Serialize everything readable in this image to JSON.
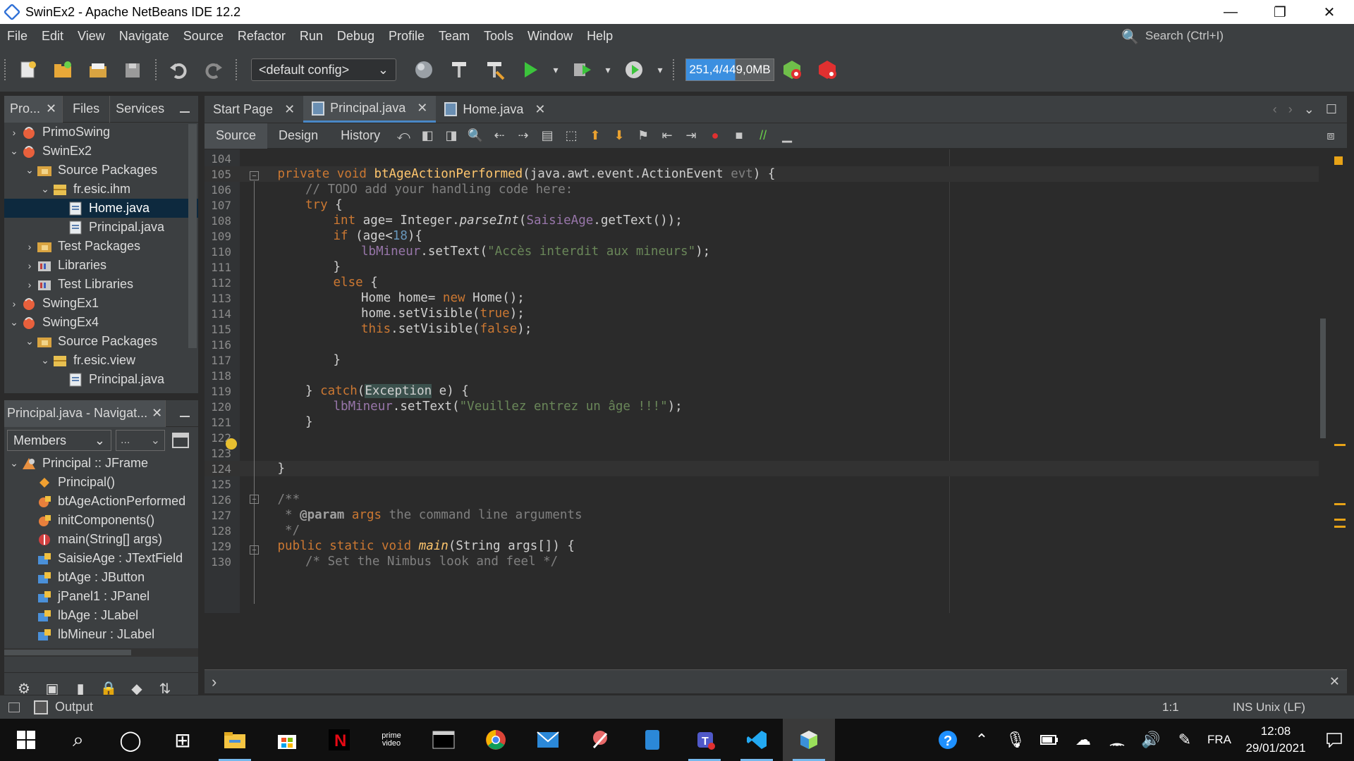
{
  "window": {
    "title": "SwinEx2 - Apache NetBeans IDE 12.2",
    "minimize": "—",
    "restore": "❐",
    "close": "✕"
  },
  "menu": {
    "items": [
      "File",
      "Edit",
      "View",
      "Navigate",
      "Source",
      "Refactor",
      "Run",
      "Debug",
      "Profile",
      "Team",
      "Tools",
      "Window",
      "Help"
    ],
    "search_placeholder": "Search (Ctrl+I)"
  },
  "toolbar": {
    "config": "<default config>",
    "memory": "251,4/449,0MB",
    "memory_used_fraction": 0.56
  },
  "projects_panel": {
    "tabs": [
      "Pro...",
      "Files",
      "Services"
    ],
    "tree": [
      {
        "label": "PrimoSwing",
        "level": 0,
        "expander": "›",
        "icon": "project-icon",
        "selected": false
      },
      {
        "label": "SwinEx2",
        "level": 0,
        "expander": "⌄",
        "icon": "project-icon",
        "selected": false
      },
      {
        "label": "Source Packages",
        "level": 1,
        "expander": "⌄",
        "icon": "package-folder-icon",
        "selected": false
      },
      {
        "label": "fr.esic.ihm",
        "level": 2,
        "expander": "⌄",
        "icon": "package-icon",
        "selected": false
      },
      {
        "label": "Home.java",
        "level": 3,
        "expander": "",
        "icon": "java-file-icon",
        "selected": true
      },
      {
        "label": "Principal.java",
        "level": 3,
        "expander": "",
        "icon": "java-file-icon",
        "selected": false
      },
      {
        "label": "Test Packages",
        "level": 1,
        "expander": "›",
        "icon": "package-folder-icon",
        "selected": false
      },
      {
        "label": "Libraries",
        "level": 1,
        "expander": "›",
        "icon": "library-icon",
        "selected": false
      },
      {
        "label": "Test Libraries",
        "level": 1,
        "expander": "›",
        "icon": "library-icon",
        "selected": false
      },
      {
        "label": "SwingEx1",
        "level": 0,
        "expander": "›",
        "icon": "project-icon",
        "selected": false
      },
      {
        "label": "SwingEx4",
        "level": 0,
        "expander": "⌄",
        "icon": "project-icon",
        "selected": false
      },
      {
        "label": "Source Packages",
        "level": 1,
        "expander": "⌄",
        "icon": "package-folder-icon",
        "selected": false
      },
      {
        "label": "fr.esic.view",
        "level": 2,
        "expander": "⌄",
        "icon": "package-icon",
        "selected": false
      },
      {
        "label": "Principal.java",
        "level": 3,
        "expander": "",
        "icon": "java-file-icon",
        "selected": false
      }
    ]
  },
  "navigator_panel": {
    "title": "Principal.java - Navigat...",
    "members_select": "Members",
    "filter_select": "...",
    "tree": [
      {
        "label": "Principal :: JFrame",
        "level": 0,
        "expander": "⌄",
        "icon": "class-icon"
      },
      {
        "label": "Principal()",
        "level": 1,
        "expander": "",
        "icon": "constructor-icon"
      },
      {
        "label": "btAgeActionPerformed",
        "level": 1,
        "expander": "",
        "icon": "private-method-icon"
      },
      {
        "label": "initComponents()",
        "level": 1,
        "expander": "",
        "icon": "private-method-icon"
      },
      {
        "label": "main(String[] args)",
        "level": 1,
        "expander": "",
        "icon": "static-method-icon"
      },
      {
        "label": "SaisieAge : JTextField",
        "level": 1,
        "expander": "",
        "icon": "private-field-icon"
      },
      {
        "label": "btAge : JButton",
        "level": 1,
        "expander": "",
        "icon": "private-field-icon"
      },
      {
        "label": "jPanel1 : JPanel",
        "level": 1,
        "expander": "",
        "icon": "private-field-icon"
      },
      {
        "label": "lbAge : JLabel",
        "level": 1,
        "expander": "",
        "icon": "private-field-icon"
      },
      {
        "label": "lbMineur : JLabel",
        "level": 1,
        "expander": "",
        "icon": "private-field-icon"
      }
    ]
  },
  "editor": {
    "tabs": [
      {
        "label": "Start Page",
        "active": false,
        "file": false
      },
      {
        "label": "Principal.java",
        "active": true,
        "file": true
      },
      {
        "label": "Home.java",
        "active": false,
        "file": true
      }
    ],
    "subtabs": [
      "Source",
      "Design",
      "History"
    ],
    "lines": [
      {
        "n": "104",
        "indent": 0,
        "segs": []
      },
      {
        "n": "105",
        "indent": 1,
        "segs": [
          [
            "kw",
            "private void "
          ],
          [
            "fn",
            "btAgeActionPerformed"
          ],
          [
            "",
            "(java.awt.event.ActionEvent "
          ],
          [
            "cmt",
            "evt"
          ],
          [
            "",
            ") {"
          ]
        ]
      },
      {
        "n": "106",
        "indent": 2,
        "segs": [
          [
            "cmt",
            "// TODO add your handling code here:"
          ]
        ]
      },
      {
        "n": "107",
        "indent": 2,
        "segs": [
          [
            "kw",
            "try"
          ],
          [
            "",
            " {"
          ]
        ]
      },
      {
        "n": "108",
        "indent": 3,
        "segs": [
          [
            "kw",
            "int "
          ],
          [
            "",
            "age= Integer."
          ],
          [
            "ital",
            "parseInt"
          ],
          [
            "",
            "("
          ],
          [
            "fld",
            "SaisieAge"
          ],
          [
            "",
            ".getText());"
          ]
        ]
      },
      {
        "n": "109",
        "indent": 3,
        "segs": [
          [
            "kw",
            "if "
          ],
          [
            "",
            "(age<"
          ],
          [
            "num",
            "18"
          ],
          [
            "",
            "){"
          ]
        ]
      },
      {
        "n": "110",
        "indent": 4,
        "segs": [
          [
            "fld",
            "lbMineur"
          ],
          [
            "",
            ".setText("
          ],
          [
            "str",
            "\"Accès interdit aux mineurs\""
          ],
          [
            "",
            ");"
          ]
        ]
      },
      {
        "n": "111",
        "indent": 3,
        "segs": [
          [
            "",
            "}"
          ]
        ]
      },
      {
        "n": "112",
        "indent": 3,
        "segs": [
          [
            "kw",
            "else "
          ],
          [
            "",
            "{"
          ]
        ]
      },
      {
        "n": "113",
        "indent": 4,
        "segs": [
          [
            "",
            "Home home= "
          ],
          [
            "kw",
            "new "
          ],
          [
            "",
            "Home();"
          ]
        ]
      },
      {
        "n": "114",
        "indent": 4,
        "segs": [
          [
            "",
            "home.setVisible("
          ],
          [
            "kw",
            "true"
          ],
          [
            "",
            ");"
          ]
        ]
      },
      {
        "n": "115",
        "indent": 4,
        "segs": [
          [
            "kw",
            "this"
          ],
          [
            "",
            ".setVisible("
          ],
          [
            "kw",
            "false"
          ],
          [
            "",
            ");"
          ]
        ]
      },
      {
        "n": "116",
        "indent": 0,
        "segs": []
      },
      {
        "n": "117",
        "indent": 3,
        "segs": [
          [
            "",
            "}"
          ]
        ]
      },
      {
        "n": "118",
        "indent": 0,
        "segs": []
      },
      {
        "n": "119",
        "indent": 2,
        "segs": [
          [
            "",
            "} "
          ],
          [
            "kw",
            "catch"
          ],
          [
            "",
            "("
          ],
          [
            "hl",
            "Exception"
          ],
          [
            "",
            " e) {"
          ]
        ]
      },
      {
        "n": "120",
        "indent": 3,
        "segs": [
          [
            "fld",
            "lbMineur"
          ],
          [
            "",
            ".setText("
          ],
          [
            "str",
            "\"Veuillez entrez un âge !!!\""
          ],
          [
            "",
            ");"
          ]
        ]
      },
      {
        "n": "121",
        "indent": 2,
        "segs": [
          [
            "",
            "}"
          ]
        ]
      },
      {
        "n": "122",
        "indent": 0,
        "segs": []
      },
      {
        "n": "123",
        "indent": 0,
        "segs": []
      },
      {
        "n": "124",
        "indent": 1,
        "segs": [
          [
            "",
            "}"
          ]
        ]
      },
      {
        "n": "125",
        "indent": 0,
        "segs": []
      },
      {
        "n": "126",
        "indent": 1,
        "segs": [
          [
            "cmt",
            "/**"
          ]
        ]
      },
      {
        "n": "127",
        "indent": 1,
        "segs": [
          [
            "cmt",
            " * "
          ],
          [
            "cmtb",
            "@param"
          ],
          [
            "cmt",
            " "
          ],
          [
            "kwc",
            "args"
          ],
          [
            "cmt",
            " the command line arguments"
          ]
        ]
      },
      {
        "n": "128",
        "indent": 1,
        "segs": [
          [
            "cmt",
            " */"
          ]
        ]
      },
      {
        "n": "129",
        "indent": 1,
        "segs": [
          [
            "kw",
            "public static void "
          ],
          [
            "fni",
            "main"
          ],
          [
            "",
            "(String args[]) {"
          ]
        ]
      },
      {
        "n": "130",
        "indent": 2,
        "segs": [
          [
            "cmt",
            "/* Set the Nimbus look and feel */"
          ]
        ]
      }
    ]
  },
  "statusbar": {
    "output": "Output",
    "position": "1:1",
    "mode": "INS Unix (LF)"
  },
  "taskbar": {
    "apps": [
      "windows-start-icon",
      "search-icon",
      "cortana-icon",
      "task-view-icon",
      "file-explorer-icon",
      "store-icon",
      "netflix-icon",
      "prime-video-icon",
      "terminal-icon",
      "chrome-icon",
      "mail-icon",
      "snip-icon",
      "phone-icon",
      "teams-icon",
      "vscode-icon",
      "netbeans-icon"
    ],
    "prime_label": "prime video",
    "language": "FRA",
    "time": "12:08",
    "date": "29/01/2021"
  },
  "colors": {
    "keyword": "#cc7832",
    "method": "#ffc66d",
    "string": "#6a8759",
    "number": "#6897bb",
    "comment": "#808080",
    "field": "#9876aa"
  }
}
